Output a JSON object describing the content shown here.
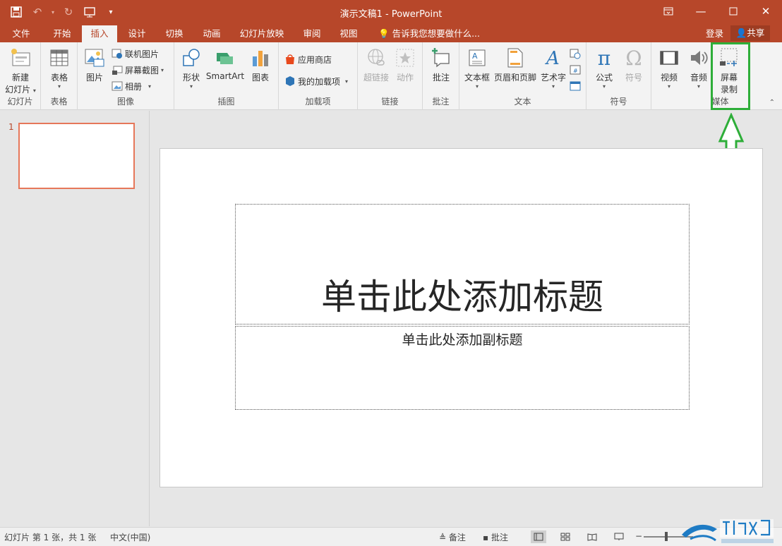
{
  "window": {
    "title": "演示文稿1 - PowerPoint",
    "controls": [
      "ribbon-display",
      "minimize",
      "maximize",
      "close"
    ]
  },
  "tabs": [
    {
      "label": "文件",
      "active": false
    },
    {
      "label": "开始",
      "active": false
    },
    {
      "label": "插入",
      "active": true
    },
    {
      "label": "设计",
      "active": false
    },
    {
      "label": "切换",
      "active": false
    },
    {
      "label": "动画",
      "active": false
    },
    {
      "label": "幻灯片放映",
      "active": false
    },
    {
      "label": "审阅",
      "active": false
    },
    {
      "label": "视图",
      "active": false
    }
  ],
  "tell_me": "告诉我您想要做什么...",
  "login": "登录",
  "share": "共享",
  "ribbon": {
    "groups": {
      "slides": "幻灯片",
      "tables": "表格",
      "images": "图像",
      "illustrations": "插图",
      "addins": "加载项",
      "links": "链接",
      "comments": "批注",
      "text": "文本",
      "symbols": "符号",
      "media": "媒体"
    },
    "new_slide_line1": "新建",
    "new_slide_line2": "幻灯片",
    "table": "表格",
    "picture": "图片",
    "online_pictures": "联机图片",
    "screenshot": "屏幕截图",
    "photo_album": "相册",
    "shapes": "形状",
    "smartart": "SmartArt",
    "chart": "图表",
    "store": "应用商店",
    "my_addins": "我的加载项",
    "hyperlink": "超链接",
    "action": "动作",
    "comment": "批注",
    "textbox": "文本框",
    "header_footer": "页眉和页脚",
    "wordart": "艺术字",
    "equation": "公式",
    "symbol": "符号",
    "video": "视频",
    "audio": "音频",
    "screen_recording_line1": "屏幕",
    "screen_recording_line2": "录制"
  },
  "slide_panel": {
    "number": "1"
  },
  "slide": {
    "title_placeholder": "单击此处添加标题",
    "subtitle_placeholder": "单击此处添加副标题"
  },
  "statusbar": {
    "slide_info": "幻灯片 第 1 张，共 1 张",
    "language": "中文(中国)",
    "notes": "备注",
    "comments": "批注"
  },
  "colors": {
    "accent": "#b7472a",
    "highlight": "#2eae39"
  }
}
